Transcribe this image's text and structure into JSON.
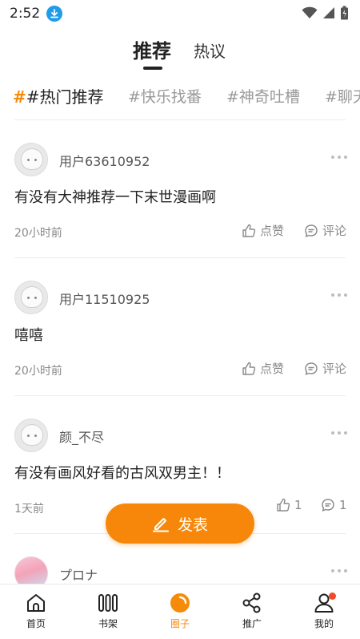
{
  "status": {
    "time": "2:52"
  },
  "tabs": [
    {
      "label": "推荐",
      "active": true
    },
    {
      "label": "热议",
      "active": false
    }
  ],
  "topics": [
    {
      "hash": "#",
      "label": "#热门推荐",
      "active": true
    },
    {
      "label": "#快乐找番",
      "active": false
    },
    {
      "label": "#神奇吐槽",
      "active": false
    },
    {
      "label": "#聊天",
      "active": false
    }
  ],
  "posts": [
    {
      "username": "用户63610952",
      "content": "有没有大神推荐一下末世漫画啊",
      "time": "20小时前",
      "like_label": "点赞",
      "comment_label": "评论"
    },
    {
      "username": "用户11510925",
      "content": "嘻嘻",
      "time": "20小时前",
      "like_label": "点赞",
      "comment_label": "评论"
    },
    {
      "username": "颜_不尽",
      "content": "有没有画风好看的古风双男主！！",
      "time": "1天前",
      "like_count": "1",
      "comment_count": "1"
    },
    {
      "username": "プロナ"
    }
  ],
  "fab": {
    "label": "发表"
  },
  "nav": [
    {
      "label": "首页",
      "icon": "home-icon"
    },
    {
      "label": "书架",
      "icon": "bookshelf-icon"
    },
    {
      "label": "圈子",
      "icon": "circle-icon",
      "active": true
    },
    {
      "label": "推广",
      "icon": "share-icon"
    },
    {
      "label": "我的",
      "icon": "profile-icon",
      "badge": true
    }
  ],
  "colors": {
    "accent": "#f7870b",
    "badge": "#f24a2b",
    "download": "#1e9be9"
  }
}
